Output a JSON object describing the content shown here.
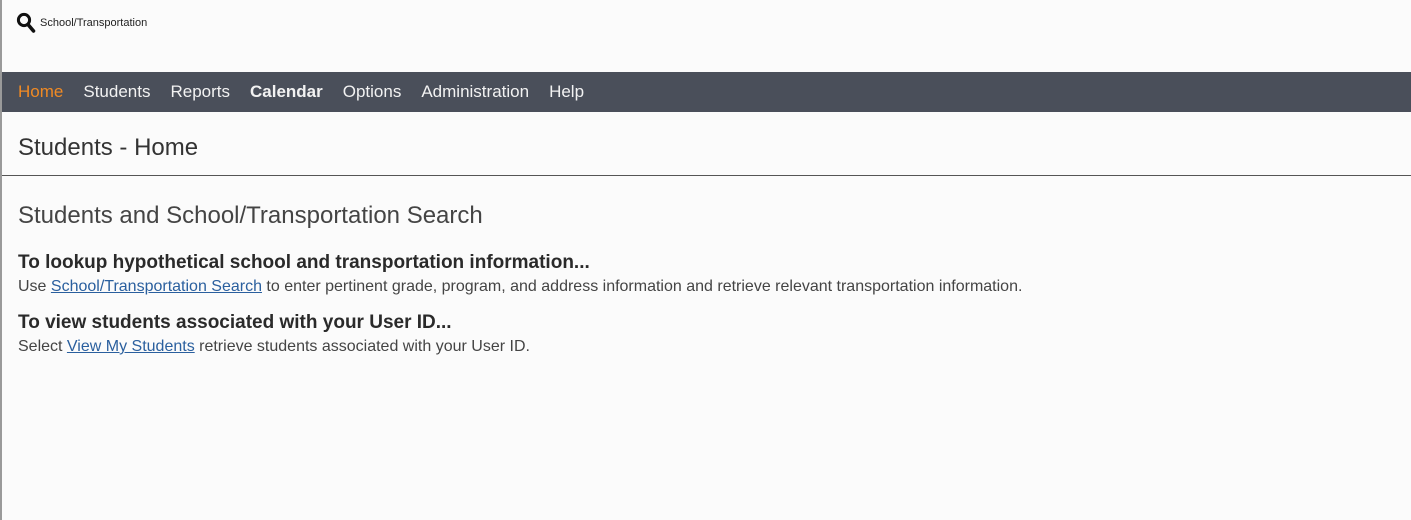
{
  "header": {
    "search_icon": "search-icon",
    "search_label": "School/Transportation"
  },
  "nav": {
    "items": [
      {
        "label": "Home",
        "active": true
      },
      {
        "label": "Students"
      },
      {
        "label": "Reports"
      },
      {
        "label": "Calendar",
        "bold": true
      },
      {
        "label": "Options"
      },
      {
        "label": "Administration"
      },
      {
        "label": "Help"
      }
    ],
    "active_color": "#f08a24",
    "background": "#4a4f5a"
  },
  "page": {
    "title": "Students - Home"
  },
  "main": {
    "section_title": "Students and School/Transportation Search",
    "lookup": {
      "heading": "To lookup hypothetical school and transportation information...",
      "prefix": "Use ",
      "link": "School/Transportation Search",
      "suffix": " to enter pertinent grade, program, and address information and retrieve relevant transportation information."
    },
    "view_students": {
      "heading": "To view students associated with your User ID...",
      "prefix": "Select ",
      "link": "View My Students",
      "suffix": " retrieve students associated with your User ID."
    },
    "link_color": "#2a5f9e"
  }
}
